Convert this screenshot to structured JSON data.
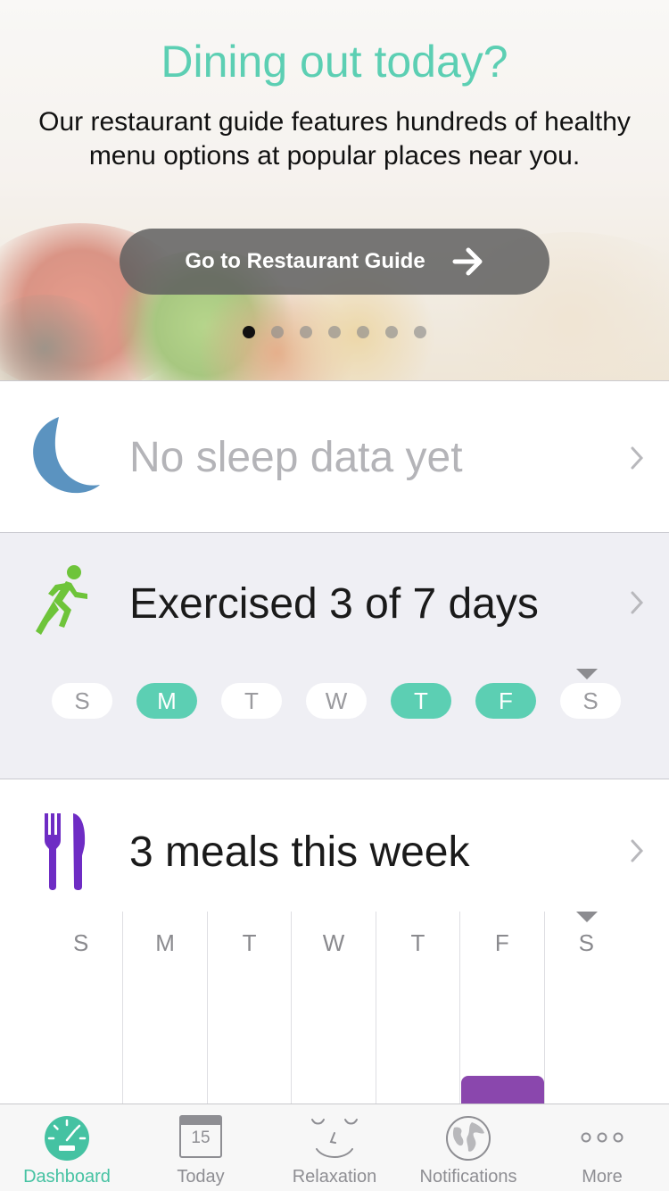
{
  "hero": {
    "title": "Dining out today?",
    "body": "Our restaurant guide features hundreds of healthy menu options at popular places near you.",
    "button_label": "Go to Restaurant Guide",
    "page_count": 7,
    "active_page": 1
  },
  "sleep": {
    "title": "No sleep data yet",
    "icon": "moon-icon",
    "icon_color": "#5b93c0"
  },
  "exercise": {
    "title": "Exercised 3 of 7 days",
    "icon": "runner-icon",
    "icon_color": "#6ec43a",
    "days": [
      {
        "label": "S",
        "active": false
      },
      {
        "label": "M",
        "active": true
      },
      {
        "label": "T",
        "active": false
      },
      {
        "label": "W",
        "active": false
      },
      {
        "label": "T",
        "active": true
      },
      {
        "label": "F",
        "active": true
      },
      {
        "label": "S",
        "active": false
      }
    ],
    "today_index": 6
  },
  "meals": {
    "title": "3 meals this week",
    "icon": "fork-knife-icon",
    "icon_color": "#6e2cc4",
    "bar_color": "#8a47ad",
    "days": [
      "S",
      "M",
      "T",
      "W",
      "T",
      "F",
      "S"
    ],
    "today_index": 6
  },
  "tabbar": {
    "active_color": "#45c2a2",
    "items": [
      {
        "label": "Dashboard",
        "icon": "dashboard-gauge-icon",
        "active": true
      },
      {
        "label": "Today",
        "icon": "calendar-icon",
        "date": "15",
        "active": false
      },
      {
        "label": "Relaxation",
        "icon": "relaxed-face-icon",
        "active": false
      },
      {
        "label": "Notifications",
        "icon": "globe-icon",
        "active": false
      },
      {
        "label": "More",
        "icon": "more-dots-icon",
        "active": false
      }
    ]
  },
  "colors": {
    "accent": "#5ccfb3",
    "exercise_bg": "#efeff4"
  }
}
